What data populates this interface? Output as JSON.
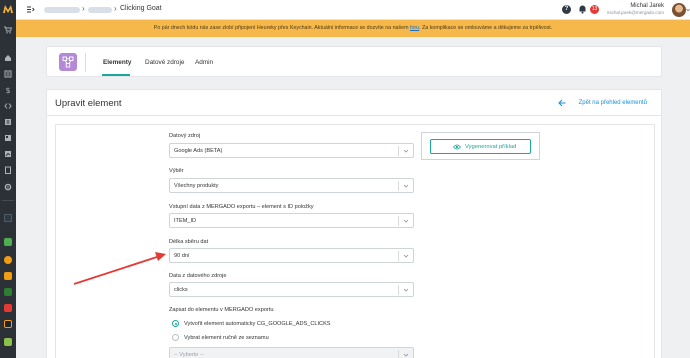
{
  "app": {
    "title": "Clicking Goat",
    "tabs": [
      {
        "label": "Elementy",
        "active": true
      },
      {
        "label": "Datové zdroje",
        "active": false
      },
      {
        "label": "Admin",
        "active": false
      }
    ]
  },
  "topbar": {
    "help_glyph": "?",
    "notifications": "13",
    "user_name": "Michal Jarek",
    "user_email": "michal.jarek@mergado.com"
  },
  "banner": {
    "text_before": "Po pár dnech kódu nás zase zlobí připojení Heureky přes Keychain. Aktuální informace se dozvíte na našem",
    "link": "foru",
    "text_after": ". Za komplikace se omlouváme a děkujeme za trpělivost."
  },
  "page": {
    "title": "Upravit element",
    "back_link": "Zpět na přehled elementů"
  },
  "form": {
    "datovy_zdroj": {
      "label": "Datový zdroj",
      "value": "Google Ads (BETA)"
    },
    "vyber": {
      "label": "Výběr",
      "value": "Všechny produkty"
    },
    "vstupni_data": {
      "label": "Vstupní data z MERGADO exportu – element s ID položky",
      "value": "ITEM_ID"
    },
    "delka": {
      "label": "Délka sběru dat",
      "value": "90 dní"
    },
    "data_zdroje": {
      "label": "Data z datového zdroje",
      "value": "clicks"
    },
    "zapsat": {
      "label": "Zapsat do elementu v MERGADO exportu",
      "options": [
        {
          "label": "Vytvořit element automaticky CG_GOOGLE_ADS_CLICKS",
          "checked": true
        },
        {
          "label": "Vybrat element ručně ze seznamu",
          "checked": false
        }
      ],
      "placeholder": "-- Vyberte --"
    },
    "generate_button": "Vygenerovat příklad"
  },
  "colors": {
    "accent": "#19a89d",
    "banner": "#f7b84b",
    "annotation_arrow": "#e53935",
    "sidebar": "#2b3136"
  },
  "icons": {
    "sidebar": [
      "mergado-logo-icon",
      "cart-icon",
      "home-icon",
      "list-icon",
      "dollar-icon",
      "code-icon",
      "calculator-icon",
      "id-icon",
      "clipboard-icon",
      "chart-icon",
      "gear-icon",
      "app-green-icon",
      "app-orange-icon",
      "app-green-dark-icon",
      "app-dark-icon",
      "app-goat-icon"
    ]
  }
}
